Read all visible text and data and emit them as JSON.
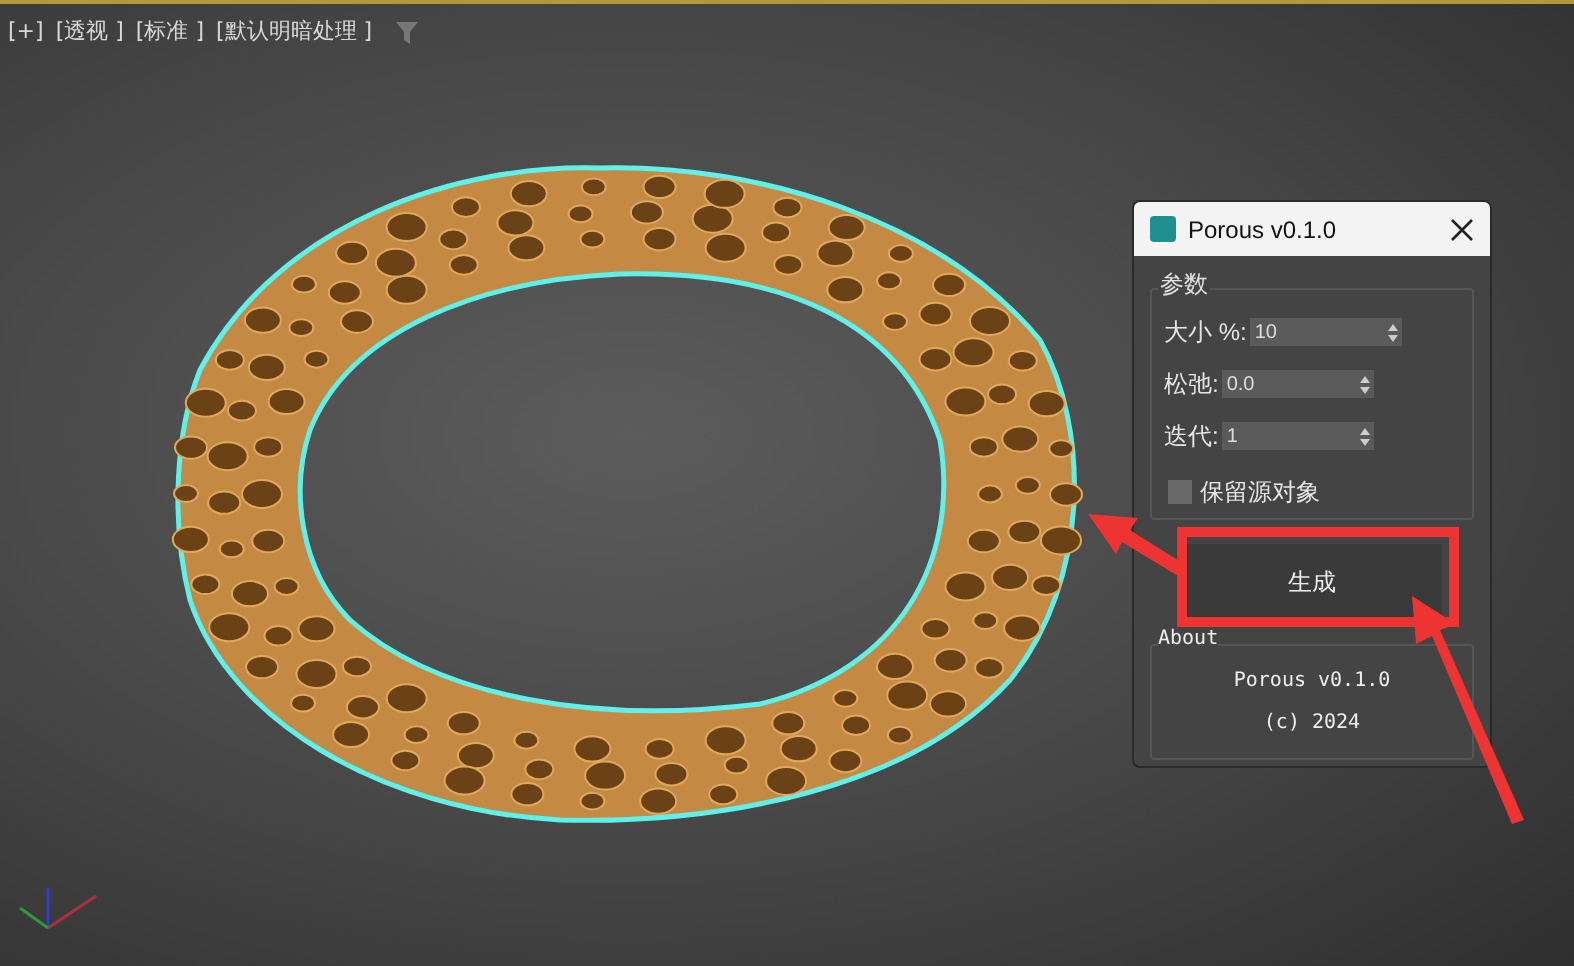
{
  "viewport": {
    "labels": [
      "[+]",
      "[透视 ]",
      "[标准 ]",
      "[默认明暗处理 ]"
    ]
  },
  "dialog": {
    "title": "Porous v0.1.0",
    "params": {
      "title": "参数",
      "fields": [
        {
          "label": "大小 %:",
          "value": "10"
        },
        {
          "label": "松弛:",
          "value": "0.0"
        },
        {
          "label": "迭代:",
          "value": "1"
        }
      ],
      "checkbox": {
        "label": "保留源对象",
        "checked": false
      }
    },
    "button": "生成",
    "about": {
      "title": "About",
      "lines": [
        "Porous v0.1.0",
        "(c) 2024"
      ]
    }
  }
}
